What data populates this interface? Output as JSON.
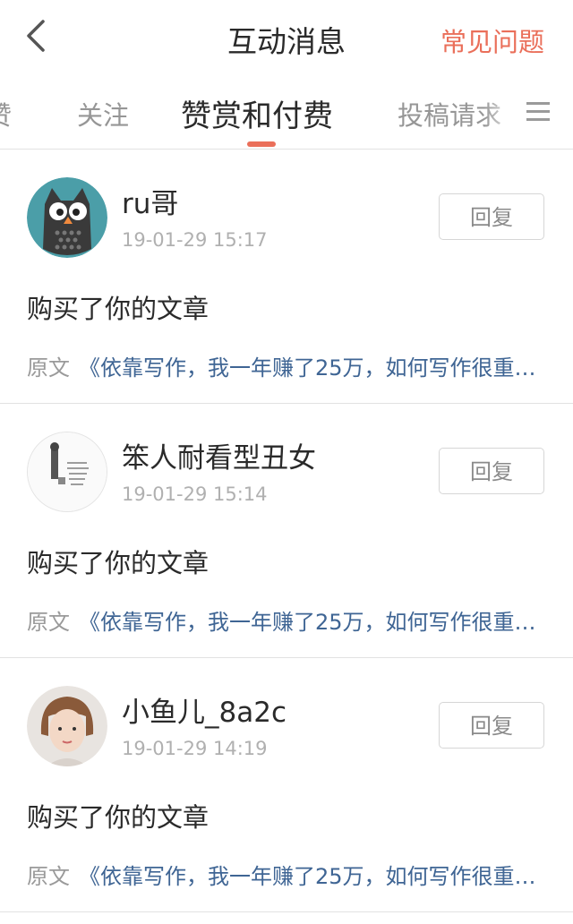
{
  "nav": {
    "title": "互动消息",
    "faq_label": "常见问题"
  },
  "tabs": {
    "items": [
      "赞",
      "关注",
      "赞赏和付费",
      "投稿请求"
    ]
  },
  "messages": [
    {
      "username": "ru哥",
      "time": "19-01-29 15:17",
      "reply_label": "回复",
      "action": "购买了你的文章",
      "origin_label": "原文",
      "origin_title": "《依靠写作，我一年赚了25万，如何写作很重…"
    },
    {
      "username": "笨人耐看型丑女",
      "time": "19-01-29 15:14",
      "reply_label": "回复",
      "action": "购买了你的文章",
      "origin_label": "原文",
      "origin_title": "《依靠写作，我一年赚了25万，如何写作很重…"
    },
    {
      "username": "小鱼儿_8a2c",
      "time": "19-01-29 14:19",
      "reply_label": "回复",
      "action": "购买了你的文章",
      "origin_label": "原文",
      "origin_title": "《依靠写作，我一年赚了25万，如何写作很重…"
    }
  ],
  "colors": {
    "accent": "#ea6f5a",
    "link": "#3f6594"
  }
}
